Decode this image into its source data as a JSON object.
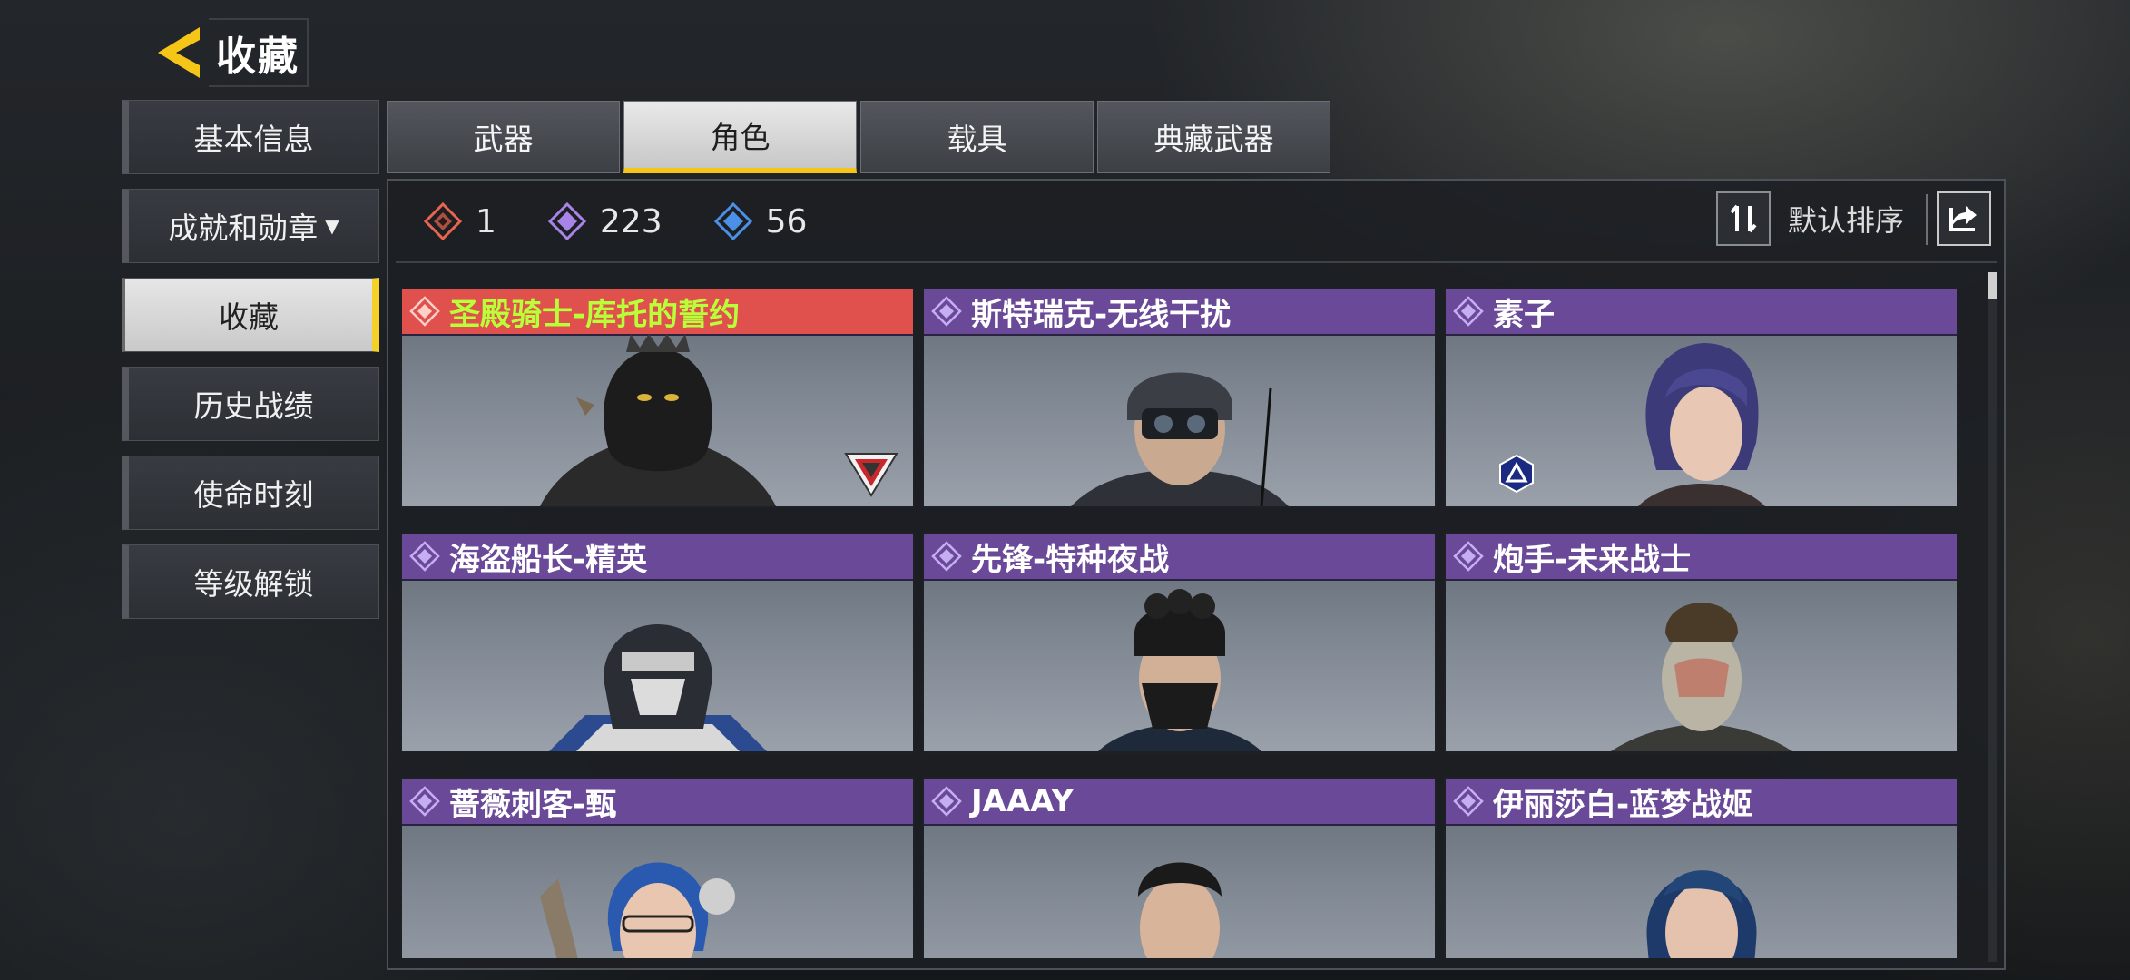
{
  "header": {
    "title": "收藏"
  },
  "sidebar": {
    "items": [
      {
        "label": "基本信息"
      },
      {
        "label": "成就和勋章"
      },
      {
        "label": "收藏"
      },
      {
        "label": "历史战绩"
      },
      {
        "label": "使命时刻"
      },
      {
        "label": "等级解锁"
      }
    ],
    "active_index": 2
  },
  "tabs": [
    {
      "label": "武器"
    },
    {
      "label": "角色"
    },
    {
      "label": "载具"
    },
    {
      "label": "典藏武器"
    }
  ],
  "active_tab_index": 1,
  "stats": [
    {
      "icon": "red-rarity-icon",
      "value": "1",
      "color": "#e8664f"
    },
    {
      "icon": "purple-rarity-icon",
      "value": "223",
      "color": "#a884e8"
    },
    {
      "icon": "blue-rarity-icon",
      "value": "56",
      "color": "#4c8fe6"
    }
  ],
  "sort": {
    "label": "默认排序"
  },
  "cards": [
    {
      "name": "圣殿骑士-库托的誓约",
      "rarity": "red"
    },
    {
      "name": "斯特瑞克-无线干扰",
      "rarity": "purple"
    },
    {
      "name": "素子",
      "rarity": "purple"
    },
    {
      "name": "海盗船长-精英",
      "rarity": "purple"
    },
    {
      "name": "先锋-特种夜战",
      "rarity": "purple"
    },
    {
      "name": "炮手-未来战士",
      "rarity": "purple"
    },
    {
      "name": "蔷薇刺客-甄",
      "rarity": "purple"
    },
    {
      "name": "JAAAY",
      "rarity": "purple"
    },
    {
      "name": "伊丽莎白-蓝梦战姬",
      "rarity": "purple"
    }
  ],
  "colors": {
    "accent": "#f5c518",
    "purple_header": "#6a4a98",
    "red_header": "#e0504c",
    "red_name": "#b8ff3a"
  }
}
